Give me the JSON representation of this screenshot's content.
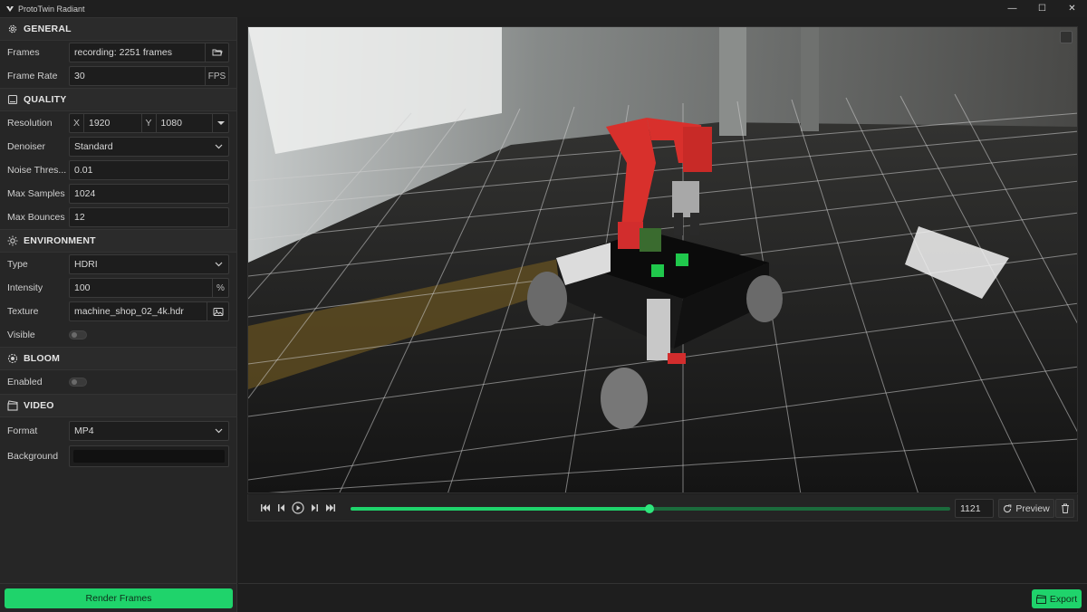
{
  "app": {
    "title": "ProtoTwin Radiant"
  },
  "window_controls": {
    "minimize": "—",
    "maximize": "☐",
    "close": "✕"
  },
  "colors": {
    "accent": "#1fd36b",
    "panel": "#262626",
    "field": "#1d1d1d"
  },
  "sections": {
    "general": {
      "title": "GENERAL",
      "frames_label": "Frames",
      "frames_value": "recording: 2251 frames",
      "frame_rate_label": "Frame Rate",
      "frame_rate_value": "30",
      "frame_rate_unit": "FPS"
    },
    "quality": {
      "title": "QUALITY",
      "resolution_label": "Resolution",
      "res_x_axis": "X",
      "res_x": "1920",
      "res_y_axis": "Y",
      "res_y": "1080",
      "denoiser_label": "Denoiser",
      "denoiser_value": "Standard",
      "noise_label": "Noise Thres...",
      "noise_value": "0.01",
      "max_samples_label": "Max Samples",
      "max_samples_value": "1024",
      "max_bounces_label": "Max Bounces",
      "max_bounces_value": "12"
    },
    "environment": {
      "title": "ENVIRONMENT",
      "type_label": "Type",
      "type_value": "HDRI",
      "intensity_label": "Intensity",
      "intensity_value": "100",
      "intensity_unit": "%",
      "texture_label": "Texture",
      "texture_value": "machine_shop_02_4k.hdr",
      "visible_label": "Visible"
    },
    "bloom": {
      "title": "BLOOM",
      "enabled_label": "Enabled"
    },
    "video": {
      "title": "VIDEO",
      "format_label": "Format",
      "format_value": "MP4",
      "background_label": "Background"
    }
  },
  "toggles": {
    "environment_visible": false,
    "bloom_enabled": false
  },
  "playback": {
    "current_frame": "1121",
    "progress": 0.498,
    "preview_label": "Preview"
  },
  "buttons": {
    "render_frames": "Render Frames",
    "export": "Export"
  }
}
